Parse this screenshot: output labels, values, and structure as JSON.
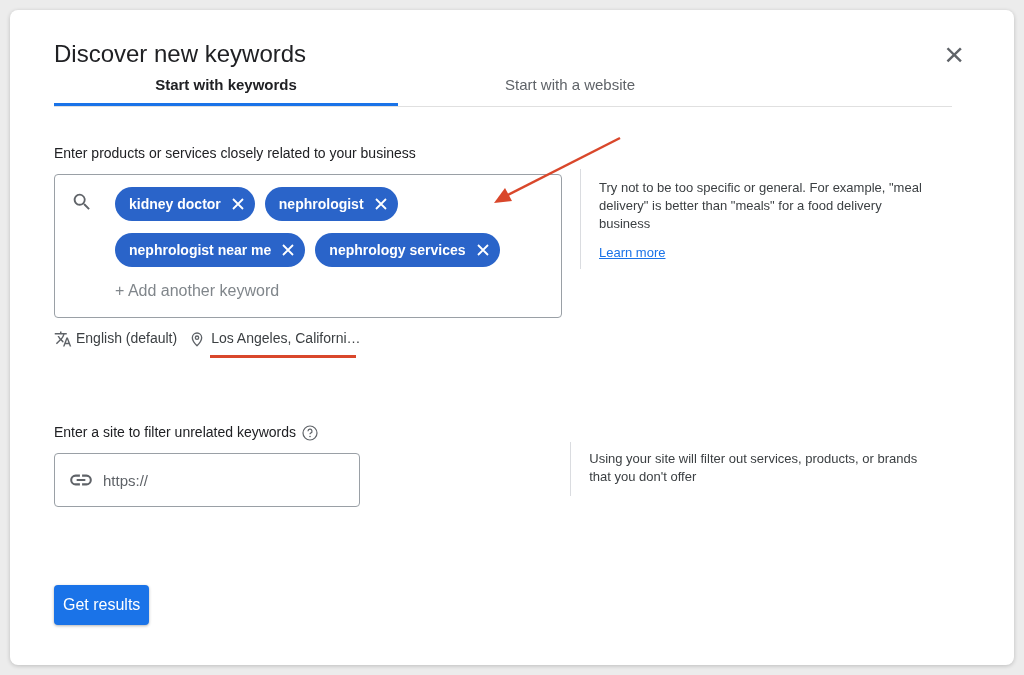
{
  "dialog": {
    "title": "Discover new keywords",
    "close": "×"
  },
  "tabs": [
    {
      "label": "Start with keywords",
      "selected": true
    },
    {
      "label": "Start with a website",
      "selected": false
    }
  ],
  "keywords_section": {
    "label": "Enter products or services closely related to your business",
    "chips": [
      {
        "text": "kidney doctor"
      },
      {
        "text": "nephrologist"
      },
      {
        "text": "nephrologist near me"
      },
      {
        "text": "nephrology services"
      }
    ],
    "add_placeholder": "+ Add another keyword",
    "language": "English (default)",
    "location": "Los Angeles, Californi…",
    "hint": "Try not to be too specific or general. For example, \"meal delivery\" is better than \"meals\" for a food delivery business",
    "link": "Learn more"
  },
  "site_section": {
    "label": "Enter a site to filter unrelated keywords",
    "placeholder": "https://",
    "hint": "Using your site will filter out services, products, or brands that you don't offer"
  },
  "button": "Get results"
}
